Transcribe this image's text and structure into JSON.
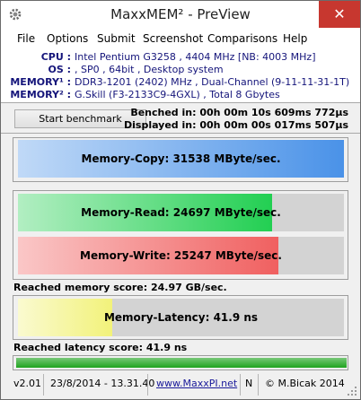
{
  "window": {
    "title": "MaxxMEM² - PreView",
    "close_glyph": "✕"
  },
  "menu": [
    "File",
    "Options",
    "Submit",
    "Screenshot",
    "Comparisons",
    "Help"
  ],
  "sysinfo": [
    {
      "label": "CPU :",
      "value": "Intel Pentium G3258 , 4404 MHz  [NB: 4003 MHz]"
    },
    {
      "label": "OS :",
      "value": ", SP0 , 64bit , Desktop system"
    },
    {
      "label": "MEMORY¹ :",
      "value": "DDR3-1201 (2402) MHz , Dual-Channel (9-11-11-31-1T)"
    },
    {
      "label": "MEMORY² :",
      "value": "G.Skill (F3-2133C9-4GXL) , Total 8 Gbytes"
    }
  ],
  "benchmark": {
    "start_label": "Start benchmark",
    "benched": "Benched in: 00h 00m 10s 609ms 772µs",
    "displayed": "Displayed in: 00h 00m 00s 017ms 507µs"
  },
  "results": {
    "copy": {
      "label": "Memory-Copy: 31538 MByte/sec.",
      "fill": 1.0,
      "color": "#4a92e8"
    },
    "read": {
      "label": "Memory-Read: 24697 MByte/sec.",
      "fill": 0.78,
      "color": "#22cf52"
    },
    "write": {
      "label": "Memory-Write: 25247 MByte/sec.",
      "fill": 0.8,
      "color": "#f06060"
    },
    "memory_score": "Reached memory score: 24.97 GB/sec.",
    "latency": {
      "label": "Memory-Latency: 41.9 ns",
      "fill": 0.29,
      "color": "#f2f27a"
    },
    "latency_score": "Reached latency score: 41.9 ns"
  },
  "progress": {
    "value": 1.0,
    "color": "#1fa31f"
  },
  "status": {
    "version": "v2.01",
    "datetime": "23/8/2014 - 13.31.40",
    "url": "www.MaxxPI.net",
    "mode": "N",
    "copyright": "© M.Bicak 2014"
  }
}
